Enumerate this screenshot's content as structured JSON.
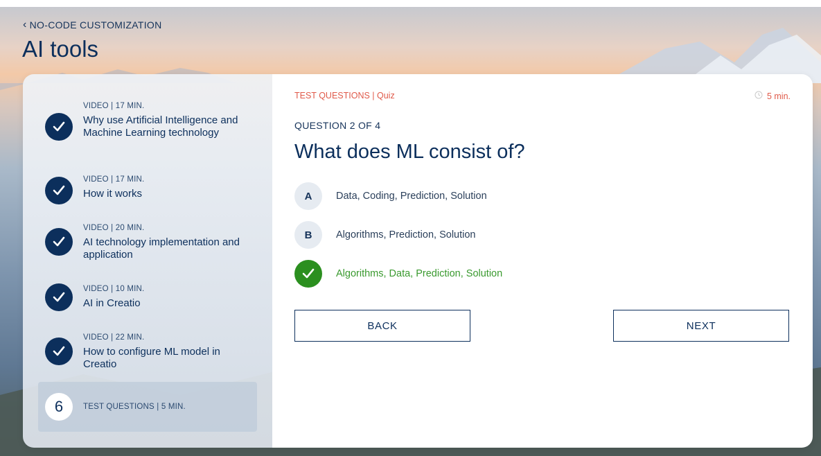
{
  "header": {
    "breadcrumb": "NO-CODE CUSTOMIZATION",
    "title": "AI tools"
  },
  "sidebar": {
    "lessons": [
      {
        "meta": "VIDEO | 17 MIN.",
        "title": "Why use Artificial Intelligence and Machine Learning technology",
        "completed": true
      },
      {
        "meta": "VIDEO | 17 MIN.",
        "title": "How it works",
        "completed": true
      },
      {
        "meta": "VIDEO | 20 MIN.",
        "title": "AI technology implementation and application",
        "completed": true
      },
      {
        "meta": "VIDEO | 10 MIN.",
        "title": "AI in Creatio",
        "completed": true
      },
      {
        "meta": "VIDEO | 22 MIN.",
        "title": "How to configure ML model in Creatio",
        "completed": true
      }
    ],
    "active": {
      "number": "6",
      "meta": "TEST QUESTIONS | 5 MIN."
    }
  },
  "quiz": {
    "label": "TEST QUESTIONS | Quiz",
    "duration": "5 min.",
    "counter": "QUESTION 2 OF 4",
    "question": "What does ML consist of?",
    "options": [
      {
        "letter": "A",
        "text": "Data, Coding, Prediction, Solution"
      },
      {
        "letter": "B",
        "text": "Algorithms, Prediction, Solution"
      },
      {
        "letter": "",
        "text": "Algorithms, Data, Prediction, Solution",
        "selected": true,
        "correct": true
      }
    ],
    "back_label": "BACK",
    "next_label": "NEXT"
  },
  "colors": {
    "navy": "#0c2f5c",
    "accent_red": "#e05a4a",
    "correct_green": "#2b8f1f"
  },
  "icons": {
    "back": "chevron-left-icon",
    "completed": "checkmark-icon",
    "timer": "clock-icon"
  }
}
